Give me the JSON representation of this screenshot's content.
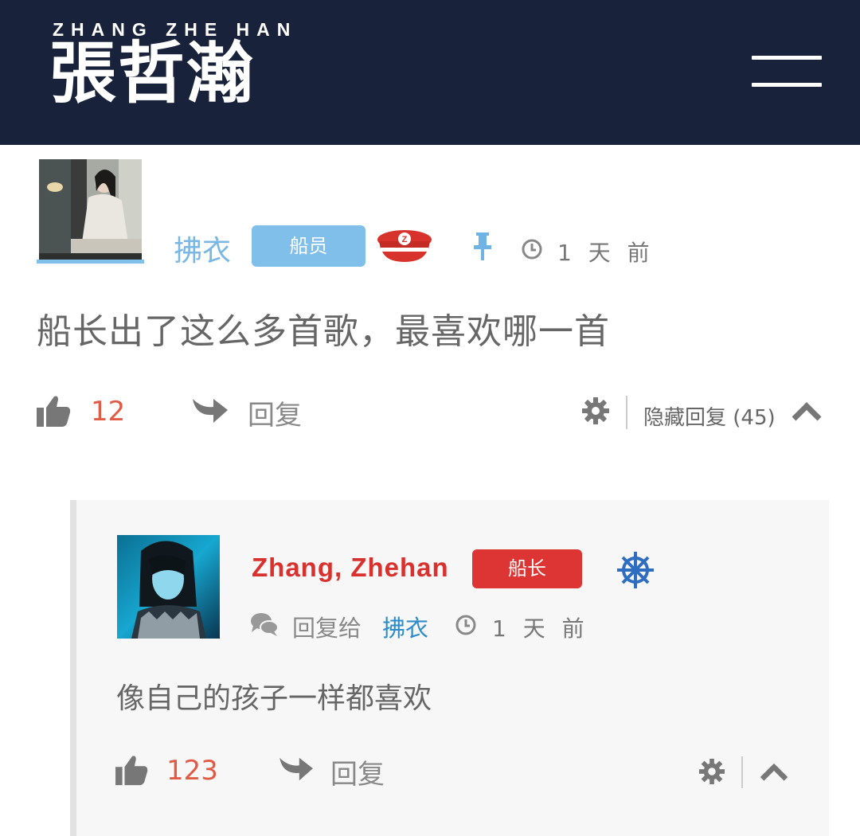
{
  "header": {
    "logo_latin": "ZHANG ZHE HAN",
    "logo_cjk": "張哲瀚",
    "menu_icon": "hamburger-menu-icon"
  },
  "post": {
    "author": "拂衣",
    "badge": "船员",
    "rank_icon": "captain-hat-icon",
    "pinned_icon": "pin-icon",
    "time": "1 天 前",
    "content": "船长出了这么多首歌，最喜欢哪一首",
    "likes": "12",
    "reply_label": "回复",
    "hide_replies_label": "隐藏回复 (45)"
  },
  "reply": {
    "author": "Zhang, Zhehan",
    "badge": "船长",
    "rank_icon": "ship-wheel-icon",
    "reply_to_label": "回复给",
    "reply_to_name": "拂衣",
    "time": "1 天 前",
    "content": "像自己的孩子一样都喜欢",
    "likes": "123",
    "reply_label": "回复"
  },
  "colors": {
    "header_bg": "#18223a",
    "member_badge": "#7fbfea",
    "captain_badge": "#dd3434",
    "like_count": "#e05a45",
    "link_blue": "#2e8cca"
  }
}
